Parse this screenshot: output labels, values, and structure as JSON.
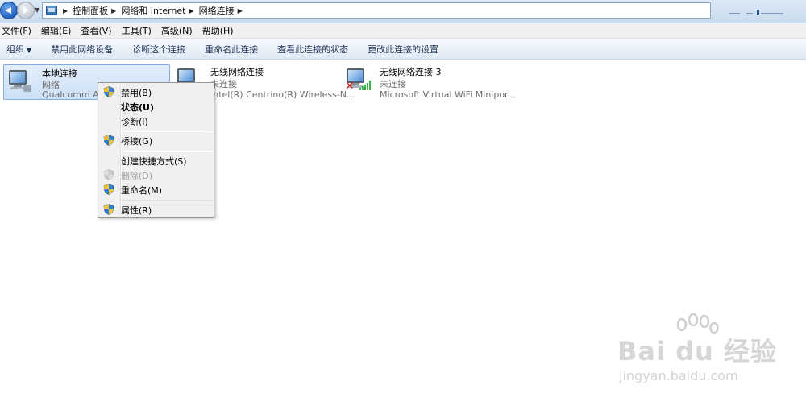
{
  "breadcrumb": [
    "控制面板",
    "网络和 Internet",
    "网络连接"
  ],
  "menu": [
    "文件(F)",
    "编辑(E)",
    "查看(V)",
    "工具(T)",
    "高级(N)",
    "帮助(H)"
  ],
  "commands": [
    "组织",
    "禁用此网络设备",
    "诊断这个连接",
    "重命名此连接",
    "查看此连接的状态",
    "更改此连接的设置"
  ],
  "connections": [
    {
      "name": "本地连接",
      "status": "网络",
      "adapter": "Qualcomm Ath",
      "selected": true
    },
    {
      "name": "无线网络连接",
      "status": "未连接",
      "adapter": "Intel(R) Centrino(R) Wireless-N..."
    },
    {
      "name": "无线网络连接 3",
      "status": "未连接",
      "adapter": "Microsoft Virtual WiFi Minipor..."
    }
  ],
  "context_menu": [
    {
      "label": "禁用(B)",
      "shield": true
    },
    {
      "label": "状态(U)",
      "bold": true
    },
    {
      "label": "诊断(I)"
    },
    {
      "label": "桥接(G)",
      "shield": true
    },
    {
      "label": "创建快捷方式(S)"
    },
    {
      "label": "删除(D)",
      "shield": true,
      "disabled": true
    },
    {
      "label": "重命名(M)",
      "shield": true
    },
    {
      "label": "属性(R)",
      "shield": true
    }
  ],
  "watermark": {
    "brand": "Bai du 经验",
    "url": "jingyan.baidu.com"
  },
  "icons": {
    "back": "back-arrow-icon",
    "forward": "forward-arrow-icon",
    "control_panel": "control-panel-icon",
    "network": "network-adapter-icon",
    "disconnected": "red-x-icon",
    "signal": "wifi-signal-icon",
    "shield": "uac-shield-icon"
  },
  "colors": {
    "accent": "#1e5fbf",
    "selected_bg": "#cde0f7",
    "error": "#d62020",
    "signal": "#39b54a"
  }
}
